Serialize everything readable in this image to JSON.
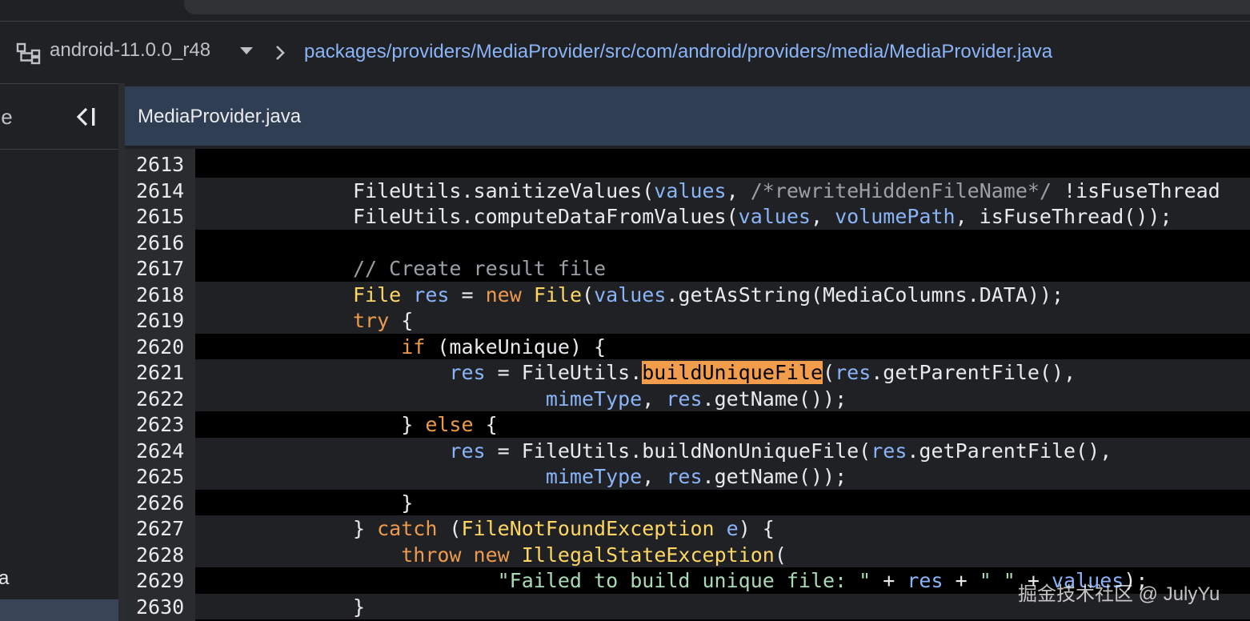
{
  "breadcrumb": {
    "branch": "android-11.0.0_r48",
    "path": "packages/providers/MediaProvider/src/com/android/providers/media/MediaProvider.java"
  },
  "sidebar": {
    "title": "tline",
    "file_label": "va"
  },
  "editor": {
    "tab_title": "MediaProvider.java"
  },
  "code": {
    "line_numbers": [
      "2613",
      "2614",
      "2615",
      "2616",
      "2617",
      "2618",
      "2619",
      "2620",
      "2621",
      "2622",
      "2623",
      "2624",
      "2625",
      "2626",
      "2627",
      "2628",
      "2629",
      "2630"
    ],
    "lines": [
      [],
      [
        {
          "t": "FileUtils.sanitizeValues(",
          "c": "p"
        },
        {
          "t": "values",
          "c": "v"
        },
        {
          "t": ", ",
          "c": "p"
        },
        {
          "t": "/*rewriteHiddenFileName*/",
          "c": "c"
        },
        {
          "t": " !isFuseThread",
          "c": "p"
        }
      ],
      [
        {
          "t": "FileUtils.computeDataFromValues(",
          "c": "p"
        },
        {
          "t": "values",
          "c": "v"
        },
        {
          "t": ", ",
          "c": "p"
        },
        {
          "t": "volumePath",
          "c": "v"
        },
        {
          "t": ", isFuseThread());",
          "c": "p"
        }
      ],
      [],
      [
        {
          "t": "// Create result file",
          "c": "c"
        }
      ],
      [
        {
          "t": "File",
          "c": "y"
        },
        {
          "t": " ",
          "c": "p"
        },
        {
          "t": "res",
          "c": "v"
        },
        {
          "t": " = ",
          "c": "p"
        },
        {
          "t": "new",
          "c": "k"
        },
        {
          "t": " ",
          "c": "p"
        },
        {
          "t": "File",
          "c": "y"
        },
        {
          "t": "(",
          "c": "p"
        },
        {
          "t": "values",
          "c": "v"
        },
        {
          "t": ".getAsString(MediaColumns.DATA));",
          "c": "p"
        }
      ],
      [
        {
          "t": "try",
          "c": "k"
        },
        {
          "t": " {",
          "c": "p"
        }
      ],
      [
        {
          "t": "    ",
          "c": "p"
        },
        {
          "t": "if",
          "c": "k"
        },
        {
          "t": " (makeUnique) {",
          "c": "p"
        }
      ],
      [
        {
          "t": "        ",
          "c": "p"
        },
        {
          "t": "res",
          "c": "v"
        },
        {
          "t": " = FileUtils.",
          "c": "p"
        },
        {
          "t": "buildUniqueFile",
          "c": "h"
        },
        {
          "t": "(",
          "c": "p"
        },
        {
          "t": "res",
          "c": "v"
        },
        {
          "t": ".getParentFile(),",
          "c": "p"
        }
      ],
      [
        {
          "t": "                ",
          "c": "p"
        },
        {
          "t": "mimeType",
          "c": "v"
        },
        {
          "t": ", ",
          "c": "p"
        },
        {
          "t": "res",
          "c": "v"
        },
        {
          "t": ".getName());",
          "c": "p"
        }
      ],
      [
        {
          "t": "    } ",
          "c": "p"
        },
        {
          "t": "else",
          "c": "k"
        },
        {
          "t": " {",
          "c": "p"
        }
      ],
      [
        {
          "t": "        ",
          "c": "p"
        },
        {
          "t": "res",
          "c": "v"
        },
        {
          "t": " = FileUtils.buildNonUniqueFile(",
          "c": "p"
        },
        {
          "t": "res",
          "c": "v"
        },
        {
          "t": ".getParentFile(),",
          "c": "p"
        }
      ],
      [
        {
          "t": "                ",
          "c": "p"
        },
        {
          "t": "mimeType",
          "c": "v"
        },
        {
          "t": ", ",
          "c": "p"
        },
        {
          "t": "res",
          "c": "v"
        },
        {
          "t": ".getName());",
          "c": "p"
        }
      ],
      [
        {
          "t": "    }",
          "c": "p"
        }
      ],
      [
        {
          "t": "} ",
          "c": "p"
        },
        {
          "t": "catch",
          "c": "k"
        },
        {
          "t": " (",
          "c": "p"
        },
        {
          "t": "FileNotFoundException",
          "c": "y"
        },
        {
          "t": " ",
          "c": "p"
        },
        {
          "t": "e",
          "c": "v"
        },
        {
          "t": ") {",
          "c": "p"
        }
      ],
      [
        {
          "t": "    ",
          "c": "p"
        },
        {
          "t": "throw",
          "c": "k"
        },
        {
          "t": " ",
          "c": "p"
        },
        {
          "t": "new",
          "c": "k"
        },
        {
          "t": " ",
          "c": "p"
        },
        {
          "t": "IllegalStateException",
          "c": "y"
        },
        {
          "t": "(",
          "c": "p"
        }
      ],
      [
        {
          "t": "            ",
          "c": "p"
        },
        {
          "t": "\"Failed to build unique file: \"",
          "c": "s"
        },
        {
          "t": " + ",
          "c": "p"
        },
        {
          "t": "res",
          "c": "v"
        },
        {
          "t": " + ",
          "c": "p"
        },
        {
          "t": "\" \"",
          "c": "s"
        },
        {
          "t": " + ",
          "c": "p"
        },
        {
          "t": "values",
          "c": "v"
        },
        {
          "t": ");",
          "c": "p"
        }
      ],
      [
        {
          "t": "}",
          "c": "p"
        }
      ]
    ]
  },
  "watermark": "掘金技术社区 @ JulyYu",
  "icons": {
    "branch": "branch-icon",
    "caret": "caret-down-icon",
    "separator": "chevron-right-icon",
    "collapse": "collapse-panel-icon"
  },
  "colors": {
    "keyword": "#ee9a4d",
    "type": "#fdd663",
    "variable": "#8ab4f8",
    "string": "#a8dab5",
    "comment": "#9aa0a6",
    "highlight": "#f29d4c",
    "header": "#303e54"
  }
}
